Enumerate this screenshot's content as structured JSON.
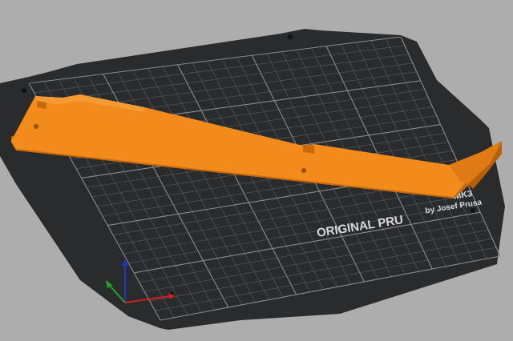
{
  "viewport": {
    "background_color": "#adadad"
  },
  "bed": {
    "surface_color": "#2a2b2d",
    "grid_minor_color": "#5c5d60",
    "grid_major_color": "#8a8b8e",
    "logo_line1": "ORIGINAL PRU",
    "logo_line1_right": "MK3",
    "logo_line2": "by Josef Prusa"
  },
  "model": {
    "color": "#f28a1c",
    "shade_color": "#d1700f",
    "dark_color": "#a85808",
    "shape": "long-bracket"
  },
  "axes": {
    "x_color": "#d11e1e",
    "y_color": "#1fa81f",
    "z_color": "#2233cc"
  }
}
